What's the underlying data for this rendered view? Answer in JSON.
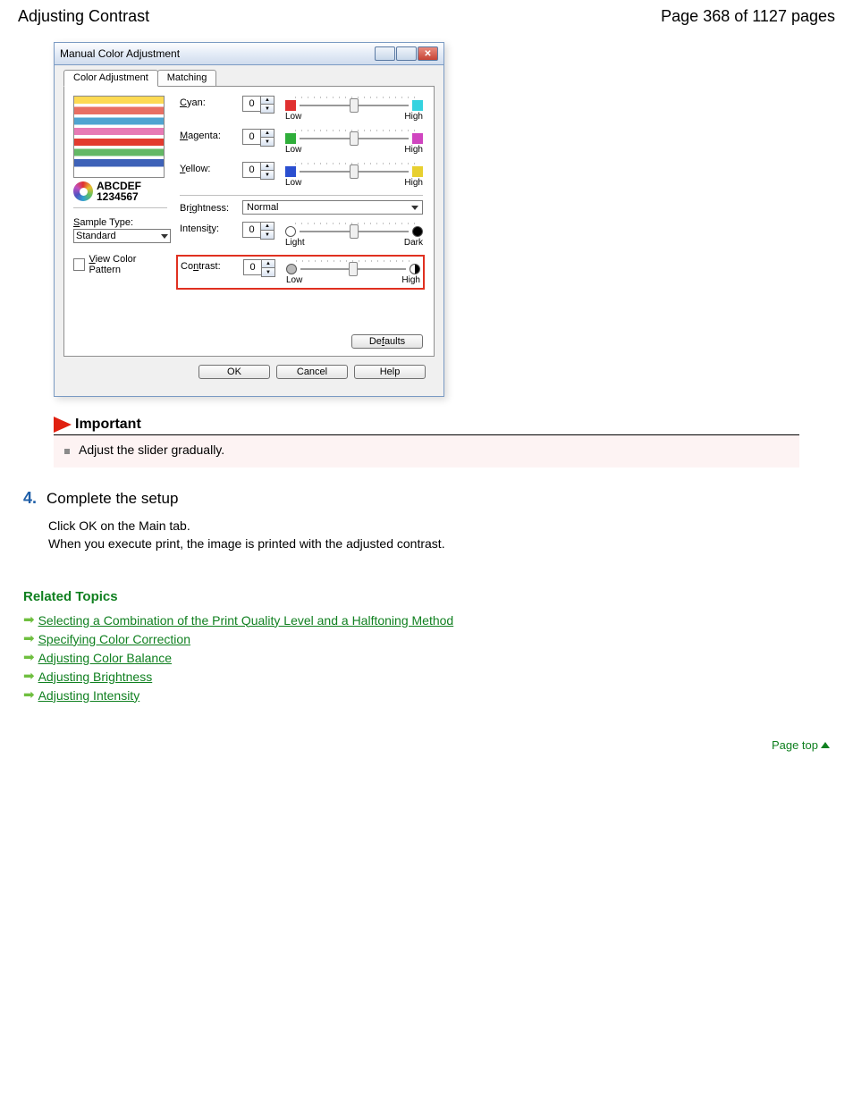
{
  "header": {
    "title": "Adjusting Contrast",
    "page_indicator": "Page 368 of 1127 pages"
  },
  "dialog": {
    "title": "Manual Color Adjustment",
    "tabs": {
      "color_adjustment": "Color Adjustment",
      "matching": "Matching"
    },
    "preview": {
      "line1": "ABCDEF",
      "line2": "1234567"
    },
    "sample_type": {
      "label": "Sample Type:",
      "value": "Standard"
    },
    "view_color_pattern": {
      "label": "View Color Pattern",
      "checked": false
    },
    "controls": {
      "cyan": {
        "label": "Cyan:",
        "value": "0",
        "low": "Low",
        "high": "High",
        "low_color": "#e03030",
        "high_color": "#35d3e0"
      },
      "magenta": {
        "label": "Magenta:",
        "value": "0",
        "low": "Low",
        "high": "High",
        "low_color": "#2fae3a",
        "high_color": "#d045c0"
      },
      "yellow": {
        "label": "Yellow:",
        "value": "0",
        "low": "Low",
        "high": "High",
        "low_color": "#2b4fd0",
        "high_color": "#e8d030"
      },
      "brightness": {
        "label": "Brightness:",
        "value": "Normal"
      },
      "intensity": {
        "label": "Intensity:",
        "value": "0",
        "low": "Light",
        "high": "Dark"
      },
      "contrast": {
        "label": "Contrast:",
        "value": "0",
        "low": "Low",
        "high": "High"
      }
    },
    "buttons": {
      "defaults": "Defaults",
      "ok": "OK",
      "cancel": "Cancel",
      "help": "Help"
    }
  },
  "important": {
    "heading": "Important",
    "text": "Adjust the slider gradually."
  },
  "step": {
    "number": "4.",
    "title": "Complete the setup",
    "line1": "Click OK on the Main tab.",
    "line2": "When you execute print, the image is printed with the adjusted contrast."
  },
  "related": {
    "heading": "Related Topics",
    "links": [
      "Selecting a Combination of the Print Quality Level and a Halftoning Method",
      "Specifying Color Correction",
      "Adjusting Color Balance",
      "Adjusting Brightness",
      "Adjusting Intensity"
    ]
  },
  "page_top": "Page top"
}
